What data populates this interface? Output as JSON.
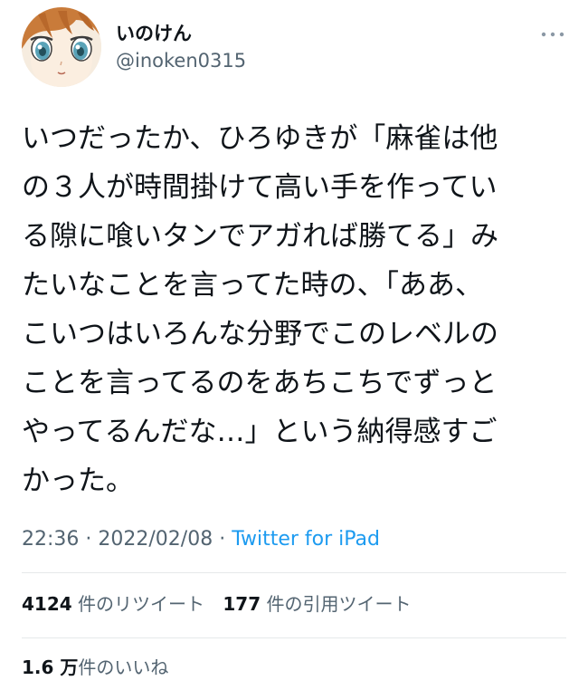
{
  "user": {
    "display_name": "いのけん",
    "username": "@inoken0315",
    "avatar_icon": "anime-girl-avatar"
  },
  "tweet": {
    "text": "いつだったか、ひろゆきが「麻雀は他の３人が時間掛けて高い手を作っている隙に喰いタンでアガれば勝てる」みたいなことを言ってた時の、「ああ、こいつはいろんな分野でこのレベルのことを言ってるのをあちこちでずっとやってるんだな…」という納得感すごかった。",
    "lines": [
      "いつだったか、ひろゆきが「麻雀は他",
      "の３人が時間掛けて高い手を作ってい",
      "る隙に喰いタンでアガれば勝てる」み",
      "たいなことを言ってた時の、「ああ、",
      "こいつはいろんな分野でこのレベルの",
      "ことを言ってるのをあちこちでずっと",
      "やってるんだな…」という納得感すご",
      "かった。"
    ],
    "time": "22:36",
    "separator": " · ",
    "date": "2022/02/08",
    "source": "Twitter for iPad"
  },
  "stats": {
    "retweets": {
      "count": "4124",
      "label": "件のリツイート"
    },
    "quotes": {
      "count": "177",
      "label": "件の引用ツイート"
    },
    "likes": {
      "count": "1.6 万",
      "label": "件のいいね"
    }
  },
  "colors": {
    "text": "#0f1419",
    "secondary": "#536471",
    "link": "#1d9bf0",
    "divider": "#e6e9ea"
  },
  "icons": {
    "more": "more-horizontal-icon"
  }
}
